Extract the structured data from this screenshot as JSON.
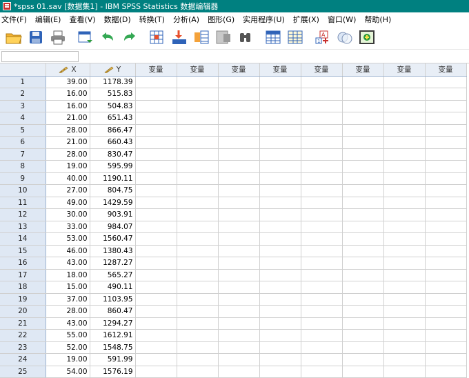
{
  "window": {
    "title": "*spss 01.sav [数据集1] - IBM SPSS Statistics 数据编辑器"
  },
  "menu": [
    "文件(F)",
    "编辑(E)",
    "查看(V)",
    "数据(D)",
    "转换(T)",
    "分析(A)",
    "图形(G)",
    "实用程序(U)",
    "扩展(X)",
    "窗口(W)",
    "帮助(H)"
  ],
  "toolbar": {
    "icons": [
      "open-folder-icon",
      "save-icon",
      "print-icon",
      "dialog-recall-icon",
      "undo-icon",
      "redo-icon",
      "goto-case-icon",
      "goto-variable-icon",
      "variables-icon",
      "run-descriptive-icon",
      "find-icon",
      "insert-cases-icon",
      "insert-variable-icon",
      "split-file-icon",
      "value-labels-icon",
      "use-sets-icon",
      "add-on-icon"
    ]
  },
  "cell_reference": {
    "value": ""
  },
  "grid": {
    "columns": [
      "X",
      "Y",
      "变量",
      "变量",
      "变量",
      "变量",
      "变量",
      "变量",
      "变量",
      "变量"
    ],
    "rows": [
      {
        "n": "1",
        "x": "39.00",
        "y": "1178.39"
      },
      {
        "n": "2",
        "x": "16.00",
        "y": "515.83"
      },
      {
        "n": "3",
        "x": "16.00",
        "y": "504.83"
      },
      {
        "n": "4",
        "x": "21.00",
        "y": "651.43"
      },
      {
        "n": "5",
        "x": "28.00",
        "y": "866.47"
      },
      {
        "n": "6",
        "x": "21.00",
        "y": "660.43"
      },
      {
        "n": "7",
        "x": "28.00",
        "y": "830.47"
      },
      {
        "n": "8",
        "x": "19.00",
        "y": "595.99"
      },
      {
        "n": "9",
        "x": "40.00",
        "y": "1190.11"
      },
      {
        "n": "10",
        "x": "27.00",
        "y": "804.75"
      },
      {
        "n": "11",
        "x": "49.00",
        "y": "1429.59"
      },
      {
        "n": "12",
        "x": "30.00",
        "y": "903.91"
      },
      {
        "n": "13",
        "x": "33.00",
        "y": "984.07"
      },
      {
        "n": "14",
        "x": "53.00",
        "y": "1560.47"
      },
      {
        "n": "15",
        "x": "46.00",
        "y": "1380.43"
      },
      {
        "n": "16",
        "x": "43.00",
        "y": "1287.27"
      },
      {
        "n": "17",
        "x": "18.00",
        "y": "565.27"
      },
      {
        "n": "18",
        "x": "15.00",
        "y": "490.11"
      },
      {
        "n": "19",
        "x": "37.00",
        "y": "1103.95"
      },
      {
        "n": "20",
        "x": "28.00",
        "y": "860.47"
      },
      {
        "n": "21",
        "x": "43.00",
        "y": "1294.27"
      },
      {
        "n": "22",
        "x": "55.00",
        "y": "1612.91"
      },
      {
        "n": "23",
        "x": "52.00",
        "y": "1548.75"
      },
      {
        "n": "24",
        "x": "19.00",
        "y": "591.99"
      },
      {
        "n": "25",
        "x": "54.00",
        "y": "1576.19"
      }
    ]
  },
  "colors": {
    "titlebar": "#008080",
    "header_bg": "#e8eef6",
    "rownum_bg": "#dfe8f4",
    "grid_line": "#d0d0d0"
  }
}
